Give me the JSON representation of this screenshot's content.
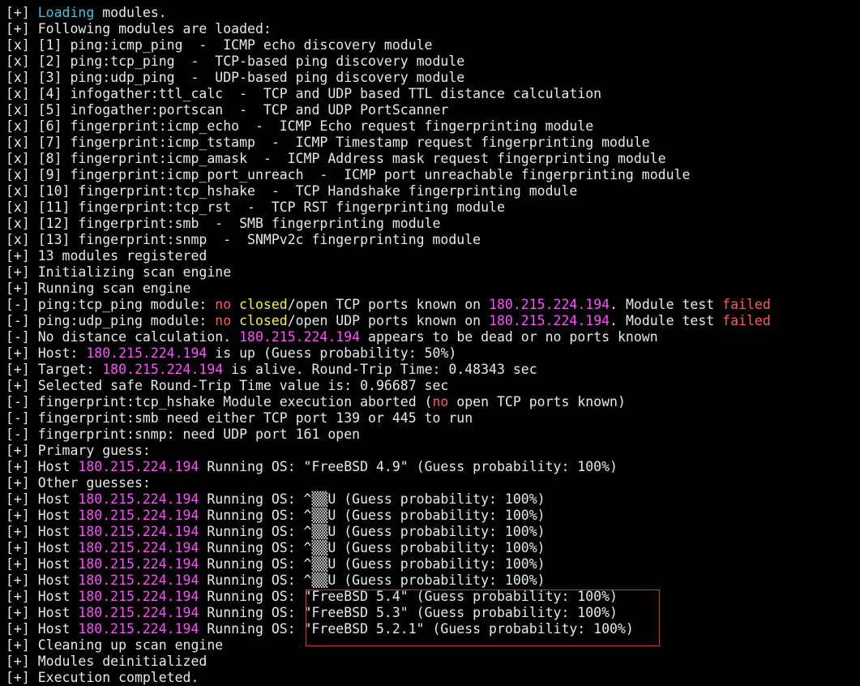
{
  "colors": {
    "foreground": "#e8e8e8",
    "background": "#000000",
    "cyan": "#3fc6df",
    "magenta": "#ff4dff",
    "red": "#ff5a5a",
    "yellow": "#f2f24a",
    "highlight_border": "#d83030"
  },
  "terminal": {
    "lines": [
      [
        {
          "t": "[+] "
        },
        {
          "t": "Loading",
          "c": "cyan"
        },
        {
          "t": " modules."
        }
      ],
      [
        {
          "t": "[+] Following modules are loaded:"
        }
      ],
      [
        {
          "t": "[x] [1] ping:icmp_ping  -  ICMP echo discovery module"
        }
      ],
      [
        {
          "t": "[x] [2] ping:tcp_ping  -  TCP-based ping discovery module"
        }
      ],
      [
        {
          "t": "[x] [3] ping:udp_ping  -  UDP-based ping discovery module"
        }
      ],
      [
        {
          "t": "[x] [4] infogather:ttl_calc  -  TCP and UDP based TTL distance calculation"
        }
      ],
      [
        {
          "t": "[x] [5] infogather:portscan  -  TCP and UDP PortScanner"
        }
      ],
      [
        {
          "t": "[x] [6] fingerprint:icmp_echo  -  ICMP Echo request fingerprinting module"
        }
      ],
      [
        {
          "t": "[x] [7] fingerprint:icmp_tstamp  -  ICMP Timestamp request fingerprinting module"
        }
      ],
      [
        {
          "t": "[x] [8] fingerprint:icmp_amask  -  ICMP Address mask request fingerprinting module"
        }
      ],
      [
        {
          "t": "[x] [9] fingerprint:icmp_port_unreach  -  ICMP port unreachable fingerprinting module"
        }
      ],
      [
        {
          "t": "[x] [10] fingerprint:tcp_hshake  -  TCP Handshake fingerprinting module"
        }
      ],
      [
        {
          "t": "[x] [11] fingerprint:tcp_rst  -  TCP RST fingerprinting module"
        }
      ],
      [
        {
          "t": "[x] [12] fingerprint:smb  -  SMB fingerprinting module"
        }
      ],
      [
        {
          "t": "[x] [13] fingerprint:snmp  -  SNMPv2c fingerprinting module"
        }
      ],
      [
        {
          "t": "[+] 13 modules registered"
        }
      ],
      [
        {
          "t": "[+] Initializing scan engine"
        }
      ],
      [
        {
          "t": "[+] Running scan engine"
        }
      ],
      [
        {
          "t": "[-] ping:tcp_ping module: "
        },
        {
          "t": "no",
          "c": "red"
        },
        {
          "t": " "
        },
        {
          "t": "closed",
          "c": "yellow"
        },
        {
          "t": "/open TCP ports known on "
        },
        {
          "t": "180.215.224.194",
          "c": "magenta"
        },
        {
          "t": ". Module test "
        },
        {
          "t": "failed",
          "c": "red"
        }
      ],
      [
        {
          "t": "[-] ping:udp_ping module: "
        },
        {
          "t": "no",
          "c": "red"
        },
        {
          "t": " "
        },
        {
          "t": "closed",
          "c": "yellow"
        },
        {
          "t": "/open UDP ports known on "
        },
        {
          "t": "180.215.224.194",
          "c": "magenta"
        },
        {
          "t": ". Module test "
        },
        {
          "t": "failed",
          "c": "red"
        }
      ],
      [
        {
          "t": "[-] No distance calculation. "
        },
        {
          "t": "180.215.224.194",
          "c": "magenta"
        },
        {
          "t": " appears to be dead or no ports known"
        }
      ],
      [
        {
          "t": "[+] Host: "
        },
        {
          "t": "180.215.224.194",
          "c": "magenta"
        },
        {
          "t": " is up (Guess probability: 50%)"
        }
      ],
      [
        {
          "t": "[+] Target: "
        },
        {
          "t": "180.215.224.194",
          "c": "magenta"
        },
        {
          "t": " is alive. Round-Trip Time: 0.48343 sec"
        }
      ],
      [
        {
          "t": "[+] Selected safe Round-Trip Time value is: 0.96687 sec"
        }
      ],
      [
        {
          "t": "[-] fingerprint:tcp_hshake Module execution aborted ("
        },
        {
          "t": "no",
          "c": "red"
        },
        {
          "t": " open TCP ports known)"
        }
      ],
      [
        {
          "t": "[-] fingerprint:smb need either TCP port 139 or 445 to run"
        }
      ],
      [
        {
          "t": "[-] fingerprint:snmp: need UDP port 161 open"
        }
      ],
      [
        {
          "t": "[+] Primary guess:"
        }
      ],
      [
        {
          "t": "[+] Host "
        },
        {
          "t": "180.215.224.194",
          "c": "magenta"
        },
        {
          "t": " Running OS: \"FreeBSD 4.9\" (Guess probability: 100%)"
        }
      ],
      [
        {
          "t": "[+] Other guesses:"
        }
      ],
      [
        {
          "t": "[+] Host "
        },
        {
          "t": "180.215.224.194",
          "c": "magenta"
        },
        {
          "t": " Running OS: ^▒▒U (Guess probability: 100%)"
        }
      ],
      [
        {
          "t": "[+] Host "
        },
        {
          "t": "180.215.224.194",
          "c": "magenta"
        },
        {
          "t": " Running OS: ^▒▒U (Guess probability: 100%)"
        }
      ],
      [
        {
          "t": "[+] Host "
        },
        {
          "t": "180.215.224.194",
          "c": "magenta"
        },
        {
          "t": " Running OS: ^▒▒U (Guess probability: 100%)"
        }
      ],
      [
        {
          "t": "[+] Host "
        },
        {
          "t": "180.215.224.194",
          "c": "magenta"
        },
        {
          "t": " Running OS: ^▒▒U (Guess probability: 100%)"
        }
      ],
      [
        {
          "t": "[+] Host "
        },
        {
          "t": "180.215.224.194",
          "c": "magenta"
        },
        {
          "t": " Running OS: ^▒▒U (Guess probability: 100%)"
        }
      ],
      [
        {
          "t": "[+] Host "
        },
        {
          "t": "180.215.224.194",
          "c": "magenta"
        },
        {
          "t": " Running OS: ^▒▒U (Guess probability: 100%)"
        }
      ],
      [
        {
          "t": "[+] Host "
        },
        {
          "t": "180.215.224.194",
          "c": "magenta"
        },
        {
          "t": " Running OS: \"FreeBSD 5.4\" (Guess probability: 100%)"
        }
      ],
      [
        {
          "t": "[+] Host "
        },
        {
          "t": "180.215.224.194",
          "c": "magenta"
        },
        {
          "t": " Running OS: \"FreeBSD 5.3\" (Guess probability: 100%)"
        }
      ],
      [
        {
          "t": "[+] Host "
        },
        {
          "t": "180.215.224.194",
          "c": "magenta"
        },
        {
          "t": " Running OS: \"FreeBSD 5.2.1\" (Guess probability: 100%)"
        }
      ],
      [
        {
          "t": "[+] Cleaning up scan engine"
        }
      ],
      [
        {
          "t": "[+] Modules deinitialized"
        }
      ],
      [
        {
          "t": "[+] Execution completed."
        }
      ]
    ]
  }
}
